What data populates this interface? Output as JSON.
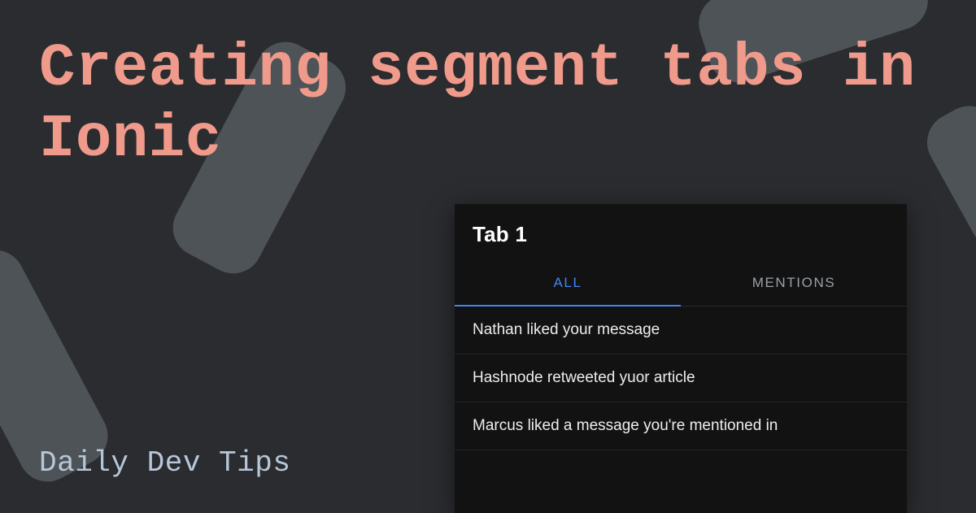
{
  "title": "Creating segment tabs in Ionic",
  "footer": "Daily Dev Tips",
  "phone": {
    "header_title": "Tab 1",
    "segments": [
      {
        "label": "ALL",
        "active": true
      },
      {
        "label": "MENTIONS",
        "active": false
      }
    ],
    "items": [
      "Nathan liked your message",
      "Hashnode retweeted yuor article",
      "Marcus liked a message you're mentioned in"
    ]
  },
  "colors": {
    "background": "#2a2c2f",
    "shape": "#4e5358",
    "title": "#f09a8b",
    "footer": "#b7c6d9",
    "accent": "#4285f4"
  }
}
